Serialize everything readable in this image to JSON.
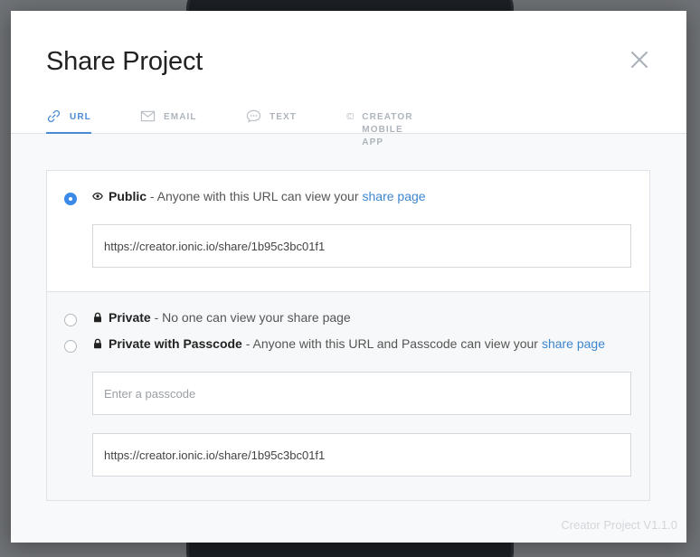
{
  "modal": {
    "title": "Share Project",
    "version": "Creator Project V1.1.0"
  },
  "tabs": [
    {
      "label": "URL",
      "icon": "link-icon",
      "active": true
    },
    {
      "label": "EMAIL",
      "icon": "envelope-icon",
      "active": false
    },
    {
      "label": "TEXT",
      "icon": "chat-bubble-icon",
      "active": false
    },
    {
      "label": "CREATOR MOBILE APP",
      "icon": "phone-icon",
      "active": false
    }
  ],
  "options": {
    "public": {
      "title": "Public",
      "desc": " - Anyone with this URL can view your",
      "link": "share page",
      "url": "https://creator.ionic.io/share/1b95c3bc01f1",
      "selected": true
    },
    "private": {
      "title": "Private",
      "desc": " - No one can view your share page",
      "selected": false
    },
    "passcode": {
      "title": "Private with Passcode",
      "desc": " - Anyone with this URL and Passcode can view your",
      "link": "share page",
      "passcode_placeholder": "Enter a passcode",
      "url": "https://creator.ionic.io/share/1b95c3bc01f1",
      "selected": false
    }
  },
  "colors": {
    "accent": "#3c8ae8",
    "link": "#3c86d0",
    "tab_inactive": "#aeb4bc"
  }
}
